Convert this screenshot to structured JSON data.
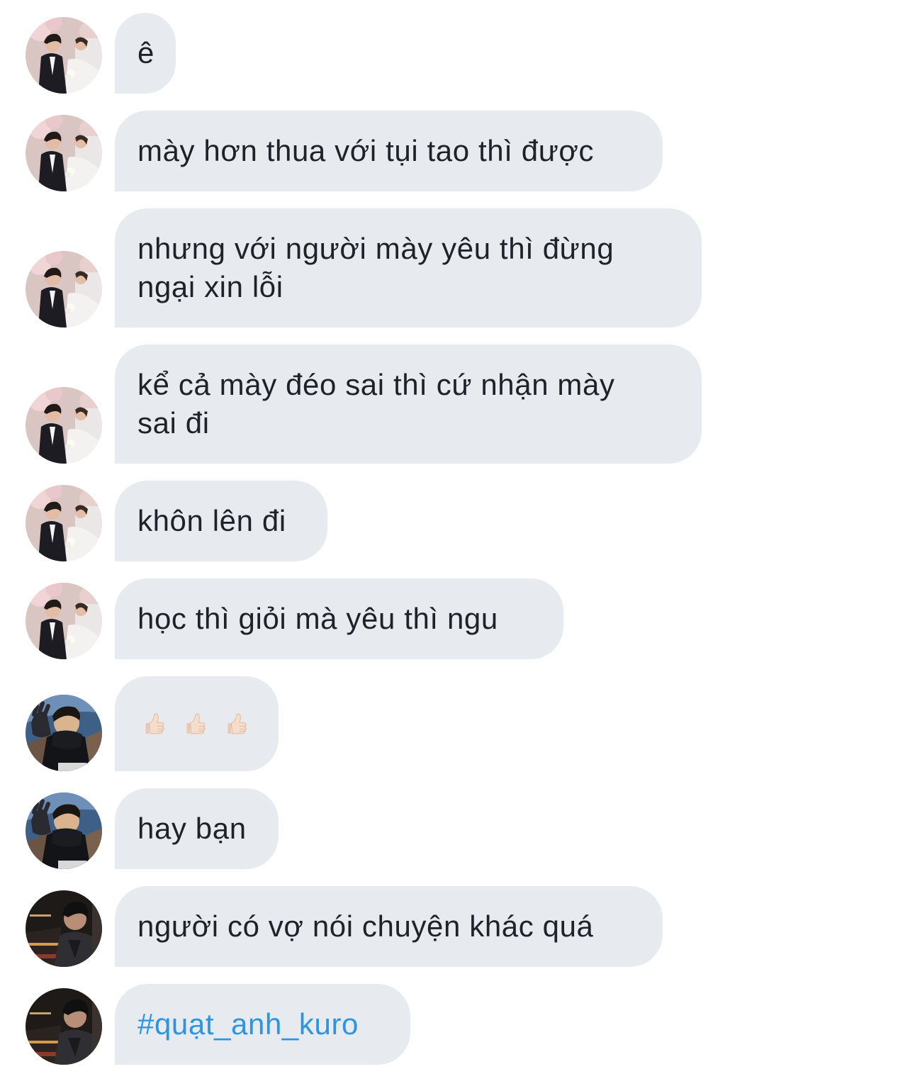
{
  "messages": [
    {
      "sender": "wedding-avatar",
      "text": "ê"
    },
    {
      "sender": "wedding-avatar",
      "text": "mày hơn thua với tụi tao thì được"
    },
    {
      "sender": "wedding-avatar",
      "text": "nhưng với người mày yêu thì đừng\nngại xin lỗi"
    },
    {
      "sender": "wedding-avatar",
      "text": "kể cả mày đéo sai thì cứ nhận mày\nsai đi"
    },
    {
      "sender": "wedding-avatar",
      "text": "khôn lên đi"
    },
    {
      "sender": "wedding-avatar",
      "text": "học thì giỏi mà yêu thì ngu"
    },
    {
      "sender": "masked-avatar",
      "emoji": [
        "thumbs-up-icon",
        "thumbs-up-icon",
        "thumbs-up-icon"
      ]
    },
    {
      "sender": "masked-avatar",
      "text": "hay bạn"
    },
    {
      "sender": "dark-avatar",
      "text": "người có vợ nói chuyện khác quá"
    },
    {
      "sender": "dark-avatar",
      "text": "#quạt_anh_kuro",
      "is_hashtag": true
    }
  ],
  "colors": {
    "bubble_bg": "#e7ebef",
    "text": "#1f2329",
    "hashtag": "#2a95e5"
  }
}
